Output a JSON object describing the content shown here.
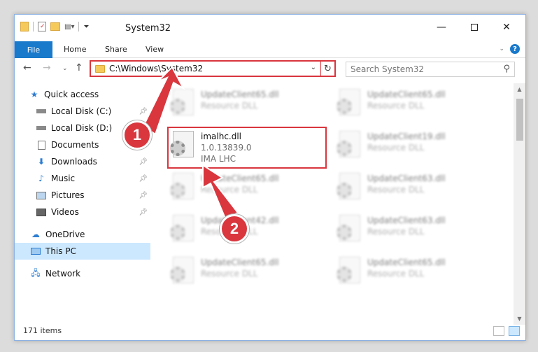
{
  "window": {
    "title": "System32"
  },
  "ribbon": {
    "file": "File",
    "home": "Home",
    "share": "Share",
    "view": "View"
  },
  "address": {
    "path": "C:\\Windows\\System32"
  },
  "search": {
    "placeholder": "Search System32"
  },
  "nav": {
    "items": [
      {
        "label": "Quick access",
        "icon": "star-icon"
      },
      {
        "label": "Local Disk (C:)",
        "icon": "drive-icon"
      },
      {
        "label": "Local Disk (D:)",
        "icon": "drive-icon"
      },
      {
        "label": "Documents",
        "icon": "documents-icon"
      },
      {
        "label": "Downloads",
        "icon": "download-icon"
      },
      {
        "label": "Music",
        "icon": "music-icon"
      },
      {
        "label": "Pictures",
        "icon": "pictures-icon"
      },
      {
        "label": "Videos",
        "icon": "videos-icon"
      },
      {
        "label": "OneDrive",
        "icon": "cloud-icon"
      },
      {
        "label": "This PC",
        "icon": "computer-icon"
      },
      {
        "label": "Network",
        "icon": "network-icon"
      }
    ]
  },
  "files": {
    "left": [
      {
        "name": "UpdateClient65.dll",
        "type": "Resource DLL"
      },
      {
        "name": "imalhc.dll",
        "version": "1.0.13839.0",
        "type": "IMA LHC"
      },
      {
        "name": "UpdateClient65.dll",
        "type": "Resource DLL"
      },
      {
        "name": "UpdateClient42.dll",
        "type": "Resource DLL"
      },
      {
        "name": "UpdateClient65.dll",
        "type": "Resource DLL"
      }
    ],
    "right": [
      {
        "name": "UpdateClient65.dll",
        "type": "Resource DLL"
      },
      {
        "name": "UpdateClient19.dll",
        "type": "Resource DLL"
      },
      {
        "name": "UpdateClient63.dll",
        "type": "Resource DLL"
      },
      {
        "name": "UpdateClient63.dll",
        "type": "Resource DLL"
      },
      {
        "name": "UpdateClient65.dll",
        "type": "Resource DLL"
      }
    ]
  },
  "status": {
    "count": "171 items"
  },
  "annotations": {
    "step1": "1",
    "step2": "2",
    "color": "#d9363e"
  }
}
